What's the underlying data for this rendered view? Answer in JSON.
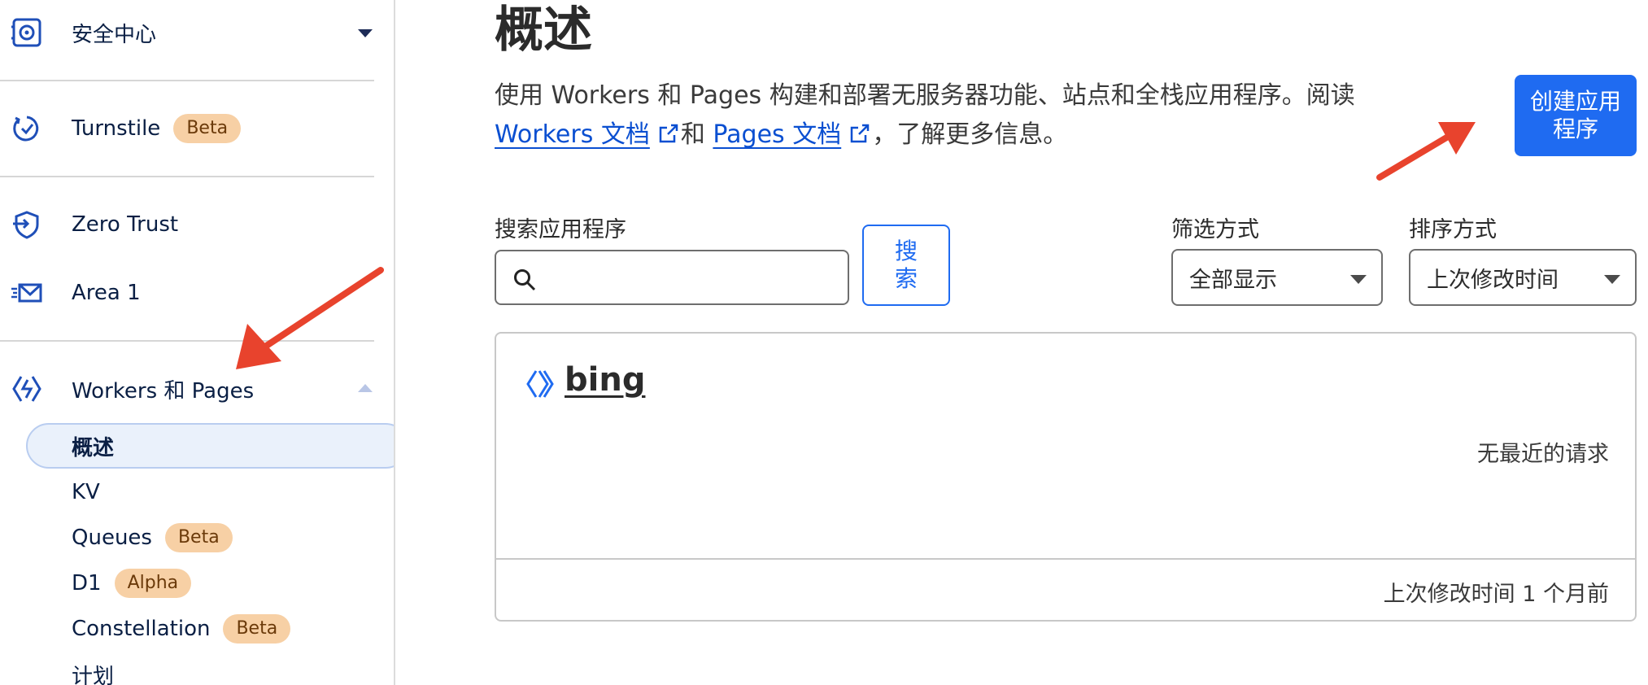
{
  "sidebar": {
    "security_center": "安全中心",
    "turnstile": {
      "label": "Turnstile",
      "badge": "Beta"
    },
    "zero_trust": "Zero Trust",
    "area1": "Area 1",
    "workers_pages": "Workers 和 Pages",
    "sub_items": {
      "overview": "概述",
      "kv": "KV",
      "queues": {
        "label": "Queues",
        "badge": "Beta"
      },
      "d1": {
        "label": "D1",
        "badge": "Alpha"
      },
      "constellation": {
        "label": "Constellation",
        "badge": "Beta"
      },
      "plans": "计划"
    }
  },
  "main": {
    "title": "概述",
    "intro": {
      "prefix": "使用 Workers 和 Pages 构建和部署无服务器功能、站点和全栈应用程序。阅读",
      "workers_docs": "Workers 文档",
      "and": "和",
      "pages_docs": "Pages 文档",
      "suffix": "，了解更多信息。"
    },
    "create_button": "创建应用程序",
    "search": {
      "label": "搜索应用程序",
      "value": "",
      "button": "搜索"
    },
    "filter": {
      "label": "筛选方式",
      "value": "全部显示"
    },
    "sort": {
      "label": "排序方式",
      "value": "上次修改时间"
    },
    "app_card": {
      "name": "bing",
      "requests_status": "无最近的请求",
      "last_modified": "上次修改时间 1 个月前"
    }
  },
  "icons": {
    "security_center": "safe-icon",
    "turnstile": "shield-check-icon",
    "zero_trust": "zero-trust-shield-icon",
    "area1": "fast-mail-icon",
    "workers_pages": "workers-icon",
    "search": "search-icon",
    "external_link": "external-link-icon",
    "app": "workers-chevrons-icon"
  },
  "colors": {
    "accent": "#1f6bf1",
    "badge_bg": "#f7d0a5",
    "annotation_arrow": "#e8432d"
  }
}
